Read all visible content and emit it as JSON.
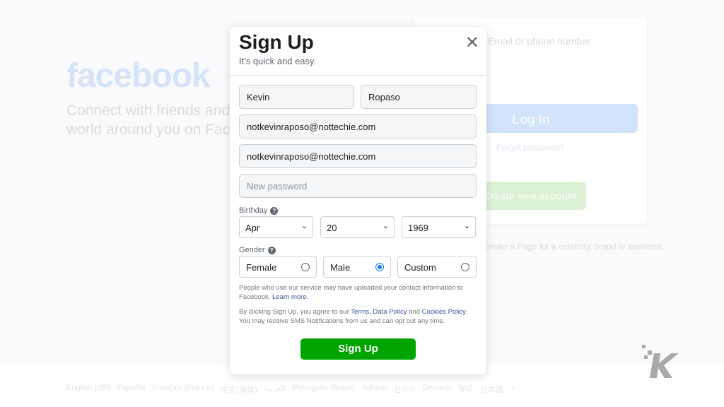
{
  "background": {
    "logo": "facebook",
    "tagline": "Connect with friends and the world around you on Facebook.",
    "login_placeholder": "Email or phone number",
    "login_button": "Log In",
    "forgot": "Forgot password?",
    "create": "Create new account",
    "create_page": "Create a Page for a celebrity, brand or business.",
    "languages": [
      "English (US)",
      "Español",
      "Français (France)",
      "中文(简体)",
      "العربية",
      "Português (Brasil)",
      "Italiano",
      "한국어",
      "Deutsch",
      "हिन्दी",
      "日本語",
      "+"
    ]
  },
  "modal": {
    "title": "Sign Up",
    "subtitle": "It's quick and easy.",
    "close": "✕",
    "first_name": "Kevin",
    "last_name": "Ropaso",
    "email": "notkevinraposo@nottechie.com",
    "email_confirm": "notkevinraposo@nottechie.com",
    "password_placeholder": "New password",
    "birthday_label": "Birthday",
    "month": "Apr",
    "day": "20",
    "year": "1969",
    "gender_label": "Gender",
    "genders": [
      {
        "label": "Female",
        "selected": false
      },
      {
        "label": "Male",
        "selected": true
      },
      {
        "label": "Custom",
        "selected": false
      }
    ],
    "contact_text": "People who use our service may have uploaded your contact information to Facebook.",
    "learn_more": "Learn more.",
    "terms_pre": "By clicking Sign Up, you agree to our",
    "terms": "Terms",
    "data_policy": "Data Policy",
    "and": "and",
    "cookies": "Cookies Policy",
    "terms_post": "You may receive SMS Notifications from us and can opt out any time.",
    "signup_button": "Sign Up"
  },
  "colors": {
    "signup": "#00a400",
    "radio": "#1877f2"
  }
}
